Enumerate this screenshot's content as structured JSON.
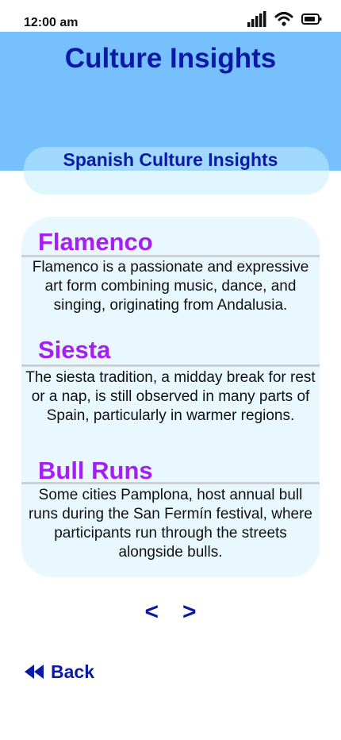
{
  "status_bar": {
    "time": "12:00 am",
    "icons": [
      "signal-icon",
      "wifi-icon",
      "battery-icon"
    ]
  },
  "header": {
    "title": "Culture Insights",
    "subtitle": "Spanish Culture Insights",
    "background_color": "#76c1fd",
    "title_color": "#0b1aa6"
  },
  "sections": [
    {
      "title": "Flamenco",
      "body": "Flamenco is a passionate and expressive art form combining music, dance, and singing, originating from Andalusia."
    },
    {
      "title": "Siesta",
      "body": "The siesta tradition, a midday break for rest or a nap, is still observed in many parts of Spain, particularly in warmer regions."
    },
    {
      "title": "Bull Runs",
      "body": "Some cities Pamplona, host annual bull runs during the San Fermín festival, where participants run through the streets alongside bulls."
    }
  ],
  "pager": {
    "prev_label": "<",
    "next_label": ">"
  },
  "back": {
    "label": "Back",
    "icon": "rewind-icon"
  },
  "colors": {
    "accent": "#0b1aa6",
    "section_title": "#a51ef4",
    "card_background": "#e9f8ff"
  }
}
